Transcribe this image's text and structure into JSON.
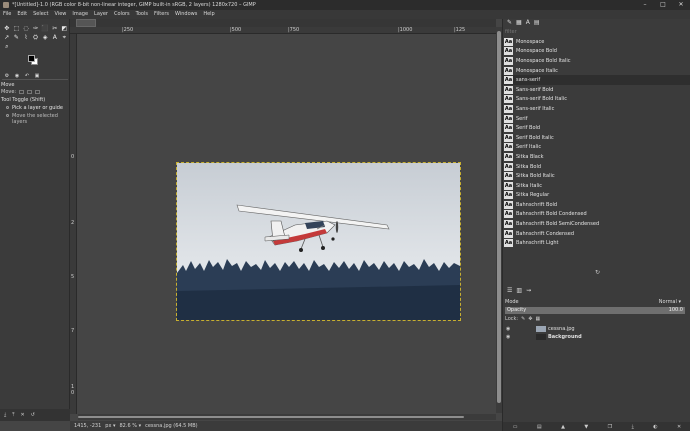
{
  "window": {
    "title": "*[Untitled]-1.0 (RGB color 8-bit non-linear integer, GIMP built-in sRGB, 2 layers) 1280x720 – GIMP",
    "controls": [
      "–",
      "□",
      "✕"
    ]
  },
  "menu": [
    "File",
    "Edit",
    "Select",
    "View",
    "Image",
    "Layer",
    "Colors",
    "Tools",
    "Filters",
    "Windows",
    "Help"
  ],
  "toolbox": {
    "tool_icons": [
      "✥",
      "⬚",
      "◌",
      "✑",
      "⬛",
      "✂",
      "◩",
      "↗",
      "✎",
      "⌇",
      "⛭",
      "◈",
      "A",
      "⌖",
      "⌕"
    ],
    "options_title": "Move",
    "mode_label": "Move:",
    "toggle_label": "Tool Toggle (Shift)",
    "option_1": "Pick a layer or guide",
    "option_2": "Move the selected layers"
  },
  "rulers": {
    "top": [
      "|250",
      "|500",
      "|750",
      "|1000",
      "|125"
    ],
    "left": [
      "0",
      "2",
      "5",
      "7",
      "1",
      "0"
    ]
  },
  "status": {
    "coords": "1415, -231",
    "unit": "px ▾",
    "zoom": "82.6 % ▾",
    "file": "cessna.jpg (64.5 MB)"
  },
  "fonts": {
    "filter_placeholder": "filter",
    "items": [
      "Monospace",
      "Monospace Bold",
      "Monospace Bold Italic",
      "Monospace Italic",
      "sans-serif",
      "Sans-serif Bold",
      "Sans-serif Bold Italic",
      "Sans-serif Italic",
      "Serif",
      "Serif Bold",
      "Serif Bold Italic",
      "Serif Italic",
      "Sitka Black",
      "Sitka Bold",
      "Sitka Bold Italic",
      "Sitka Italic",
      "Sitka Regular",
      "Bahnschrift Bold",
      "Bahnschrift Bold Condensed",
      "Bahnschrift Bold SemiCondensed",
      "Bahnschrift Condensed",
      "Bahnschrift Light"
    ],
    "selected_index": 4
  },
  "layers": {
    "mode_label": "Mode",
    "mode_value": "Normal ▾",
    "opacity_label": "Opacity",
    "opacity_value": "100.0",
    "lock_label": "Lock:",
    "items": [
      "cessna.jpg",
      "Background"
    ]
  }
}
